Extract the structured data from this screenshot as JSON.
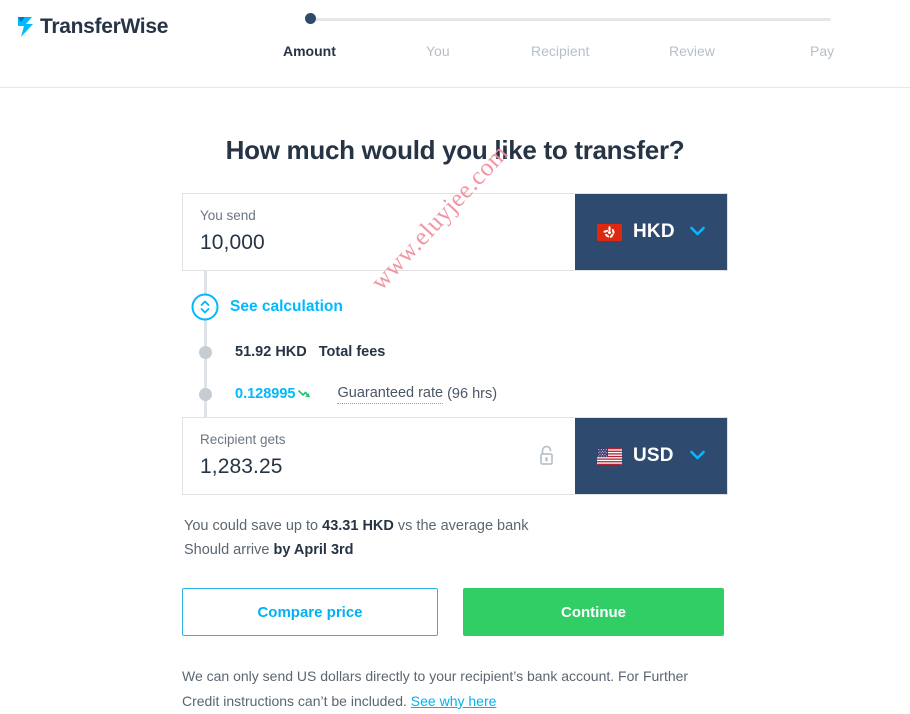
{
  "brand": {
    "name": "TransferWise",
    "logo_icon": "transferwise-arrow-icon",
    "accent_cyan": "#00b9ff",
    "navy": "#263445",
    "select_navy": "#2e4a6e",
    "green": "#31ce66"
  },
  "steps": {
    "items": [
      {
        "label": "Amount",
        "active": true
      },
      {
        "label": "You",
        "active": false
      },
      {
        "label": "Recipient",
        "active": false
      },
      {
        "label": "Review",
        "active": false
      },
      {
        "label": "Pay",
        "active": false
      }
    ]
  },
  "main": {
    "title": "How much would you like to transfer?",
    "send": {
      "label": "You send",
      "value": "10,000",
      "currency": "HKD",
      "flag": "hk-flag-icon",
      "chevron": "chevron-down-icon"
    },
    "receive": {
      "label": "Recipient gets",
      "value": "1,283.25",
      "currency": "USD",
      "flag": "us-flag-icon",
      "chevron": "chevron-down-icon",
      "lock_icon": "unlocked-padlock-icon"
    },
    "calculation": {
      "see_calculation": "See calculation",
      "toggle_icon": "expand-collapse-circle-icon",
      "fee_amount": "51.92 HKD",
      "fee_label": "Total fees",
      "rate_value": "0.128995",
      "rate_trend_icon": "trend-down-arrow-icon",
      "rate_label": "Guaranteed rate",
      "rate_suffix": "(96 hrs)"
    },
    "savings": {
      "prefix": "You could save up to ",
      "amount": "43.31 HKD",
      "suffix": " vs the average bank"
    },
    "arrival": {
      "prefix": "Should arrive ",
      "date": "by April 3rd"
    },
    "buttons": {
      "compare": "Compare price",
      "continue": "Continue"
    },
    "note": {
      "line1": "We can only send US dollars directly to your recipient’s bank account. For",
      "line2": "Further Credit instructions can’t be included. ",
      "link": "See why here"
    }
  },
  "watermark": {
    "text": "www.eluyjee.com"
  }
}
